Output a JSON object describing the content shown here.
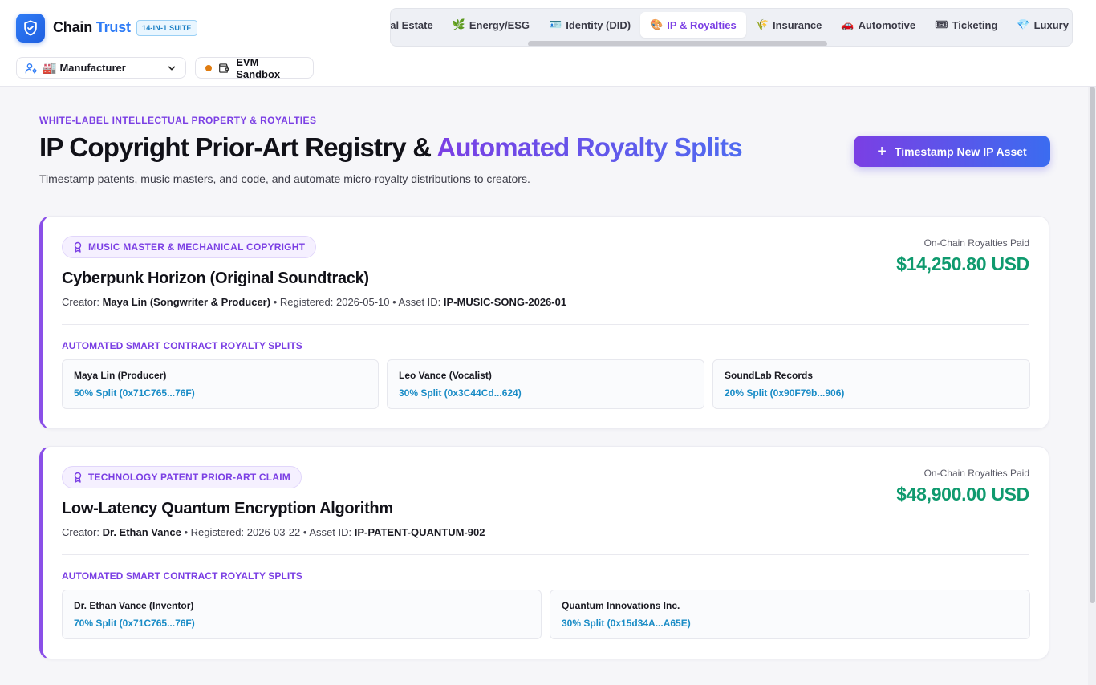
{
  "app": {
    "brand_part1": "Chain",
    "brand_part2": "Trust",
    "suite_badge": "14-IN-1 SUITE"
  },
  "role_selector": {
    "icon": "factory",
    "selected": "Manufacturer"
  },
  "network": {
    "label": "EVM Sandbox",
    "status_color": "#e07c10"
  },
  "tabs": [
    {
      "icon": "",
      "label": "eal Estate",
      "active": false
    },
    {
      "icon": "🌿",
      "label": "Energy/ESG",
      "active": false
    },
    {
      "icon": "🪪",
      "label": "Identity (DID)",
      "active": false
    },
    {
      "icon": "🎨",
      "label": "IP & Royalties",
      "active": true
    },
    {
      "icon": "🌾",
      "label": "Insurance",
      "active": false
    },
    {
      "icon": "🚗",
      "label": "Automotive",
      "active": false
    },
    {
      "icon": "🎟",
      "label": "Ticketing",
      "active": false
    },
    {
      "icon": "💎",
      "label": "Luxury",
      "active": false
    }
  ],
  "page": {
    "eyebrow": "WHITE-LABEL INTELLECTUAL PROPERTY & ROYALTIES",
    "title_part1": "IP Copyright Prior-Art Registry & ",
    "title_part2": "Automated Royalty Splits",
    "subtitle": "Timestamp patents, music masters, and code, and automate micro-royalty distributions to creators.",
    "primary_button": "Timestamp New IP Asset"
  },
  "colors": {
    "accent": "#7b3fe4",
    "brand_blue": "#2f7cf6",
    "money_green": "#0f9a6e",
    "split_blue": "#1a8cc6"
  },
  "assets": [
    {
      "category": "MUSIC MASTER & MECHANICAL COPYRIGHT",
      "title": "Cyberpunk Horizon (Original Soundtrack)",
      "creator_label": "Creator:",
      "creator": "Maya Lin (Songwriter & Producer)",
      "registered_label": "• Registered:",
      "registered": "2026-05-10",
      "asset_id_label": "• Asset ID:",
      "asset_id": "IP-MUSIC-SONG-2026-01",
      "paid_label": "On-Chain Royalties Paid",
      "paid_value": "$14,250.80 USD",
      "splits_label": "AUTOMATED SMART CONTRACT ROYALTY SPLITS",
      "splits": [
        {
          "name": "Maya Lin (Producer)",
          "value": "50% Split (0x71C765...76F)"
        },
        {
          "name": "Leo Vance (Vocalist)",
          "value": "30% Split (0x3C44Cd...624)"
        },
        {
          "name": "SoundLab Records",
          "value": "20% Split (0x90F79b...906)"
        }
      ]
    },
    {
      "category": "TECHNOLOGY PATENT PRIOR-ART CLAIM",
      "title": "Low-Latency Quantum Encryption Algorithm",
      "creator_label": "Creator:",
      "creator": "Dr. Ethan Vance",
      "registered_label": "• Registered:",
      "registered": "2026-03-22",
      "asset_id_label": "• Asset ID:",
      "asset_id": "IP-PATENT-QUANTUM-902",
      "paid_label": "On-Chain Royalties Paid",
      "paid_value": "$48,900.00 USD",
      "splits_label": "AUTOMATED SMART CONTRACT ROYALTY SPLITS",
      "splits": [
        {
          "name": "Dr. Ethan Vance (Inventor)",
          "value": "70% Split (0x71C765...76F)"
        },
        {
          "name": "Quantum Innovations Inc.",
          "value": "30% Split (0x15d34A...A65E)"
        }
      ]
    }
  ]
}
